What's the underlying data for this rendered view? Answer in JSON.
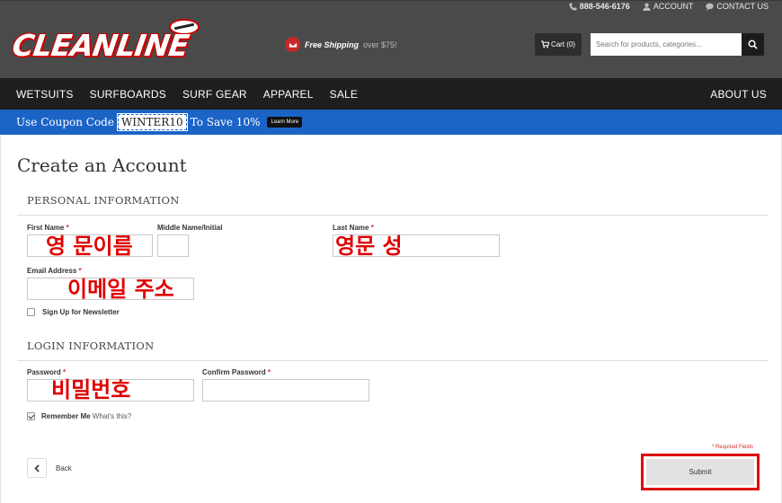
{
  "header": {
    "phone": "888-546-6176",
    "account": "ACCOUNT",
    "contact": "CONTACT US",
    "logo_text": "CLEANLINE",
    "shipping_strong": "Free Shipping",
    "shipping_sub": "over $75!",
    "cart_label": "Cart (0)",
    "search_placeholder": "Search for products, categories..."
  },
  "nav": {
    "items": [
      "WETSUITS",
      "SURFBOARDS",
      "SURF GEAR",
      "APPAREL",
      "SALE"
    ],
    "right_item": "ABOUT US"
  },
  "coupon": {
    "prefix": "Use Coupon Code",
    "code": "WINTER10",
    "suffix": "To Save 10%",
    "learn_more": "Learn More"
  },
  "form": {
    "title": "Create an Account",
    "personal_section": "PERSONAL INFORMATION",
    "first_name_label": "First Name",
    "middle_name_label": "Middle Name/Initial",
    "last_name_label": "Last Name",
    "email_label": "Email Address",
    "newsletter_label": "Sign Up for Newsletter",
    "newsletter_checked": false,
    "login_section": "LOGIN INFORMATION",
    "password_label": "Password",
    "confirm_password_label": "Confirm Password",
    "remember_label": "Remember Me",
    "remember_checked": true,
    "whats_this": "What's this?",
    "required_note": "* Required Fields",
    "back_label": "Back",
    "submit_label": "Submit",
    "required_marker": "*"
  },
  "annotations": {
    "first_name": "영 문이름",
    "last_name": "영문 성",
    "email": "이메일 주소",
    "password": "비밀번호",
    "color": "#e00000"
  },
  "colors": {
    "header_bg": "#4a4a4a",
    "nav_bg": "#1e1e1e",
    "coupon_bg": "#1b64c6",
    "accent_red": "#e00000"
  }
}
